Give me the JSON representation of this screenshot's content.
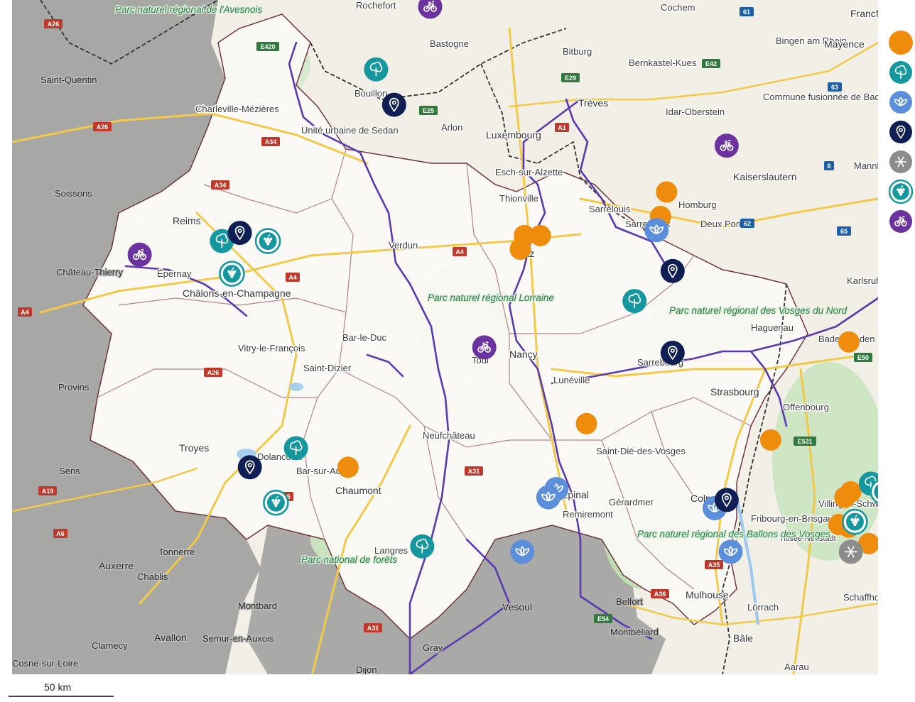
{
  "map": {
    "labels": {
      "cities": [
        "Rochefort",
        "Cochem",
        "Bastogne",
        "Bitburg",
        "Bingen am Rhein",
        "Mayence",
        "Saint-Quentin",
        "Charleville-Mézières",
        "Bouillon",
        "Bernkastel-Kues",
        "Trèves",
        "Idar-Oberstein",
        "Commune fusionnée de Bad Kreuznach",
        "Arlon",
        "Luxembourg",
        "Unité urbaine de Sedan",
        "Esch-sur-Alzette",
        "Kaiserslautern",
        "Mannheim",
        "Soissons",
        "Thionville",
        "Sarrelouis",
        "Homburg",
        "Sarrebruck",
        "Deux Ponts",
        "Reims",
        "Verdun",
        "Metz",
        "Karlsruhe",
        "Château-Thierry",
        "Épernay",
        "Châlons-en-Champagne",
        "Haguenau",
        "Bar-le-Duc",
        "Nancy",
        "Toul",
        "Vitry-le-François",
        "Saint-Dizier",
        "Lunéville",
        "Sarrebourg",
        "Baden-Baden",
        "Provins",
        "Strasbourg",
        "Offenbourg",
        "Troyes",
        "Dolancourt",
        "Bar-sur-Aube",
        "Neufchâteau",
        "Saint-Dié-des-Vosges",
        "Sens",
        "Chaumont",
        "Épinal",
        "Colmar",
        "Villingen-Schwenningen",
        "Remiremont",
        "Gérardmer",
        "Fribourg-en-Brisgau",
        "Titisee-Neustadt",
        "Tonnerre",
        "Langres",
        "Auxerre",
        "Chablis",
        "Mulhouse",
        "Lörrach",
        "Schaffhouse",
        "Montbard",
        "Vesoul",
        "Belfort",
        "Avallon",
        "Semur-en-Auxois",
        "Bâle",
        "Clamecy",
        "Cosne-sur-Loire",
        "Dijon",
        "Aarau",
        "Gray",
        "Montbéliard",
        "Francfort"
      ],
      "parks": [
        "Parc naturel régional de l'Avesnois",
        "Parc naturel régional Lorraine",
        "Parc naturel régional des Vosges du Nord",
        "Parc national de forêts",
        "Parc naturel régional des Ballons des Vosges"
      ],
      "roads": [
        "E420",
        "A26",
        "A34",
        "A4",
        "E25",
        "E29",
        "E42",
        "A1",
        "A31",
        "A5",
        "A19",
        "A6",
        "A35",
        "E54",
        "A36",
        "E531",
        "63",
        "61",
        "6",
        "62",
        "65",
        "E50"
      ]
    },
    "markers": [
      {
        "type": "orange",
        "lon": 5.44,
        "lat": 49.12
      },
      {
        "type": "orange",
        "lon": 5.52,
        "lat": 49.12
      },
      {
        "type": "orange",
        "lon": 5.42,
        "lat": 49.07
      },
      {
        "type": "orange",
        "lon": 6.15,
        "lat": 49.28
      },
      {
        "type": "orange",
        "lon": 6.12,
        "lat": 49.19
      },
      {
        "type": "orange",
        "lon": 7.06,
        "lat": 48.73
      },
      {
        "type": "orange",
        "lon": 5.75,
        "lat": 48.43
      },
      {
        "type": "orange",
        "lon": 6.67,
        "lat": 48.37
      },
      {
        "type": "orange",
        "lon": 4.56,
        "lat": 48.27
      },
      {
        "type": "orange",
        "lon": 7.34,
        "lat": 48.4
      },
      {
        "type": "orange",
        "lon": 7.52,
        "lat": 48.4
      },
      {
        "type": "orange",
        "lon": 7.45,
        "lat": 48.36
      },
      {
        "type": "orange",
        "lon": 7.51,
        "lat": 48.36
      },
      {
        "type": "orange",
        "lon": 7.43,
        "lat": 48.3
      },
      {
        "type": "orange",
        "lon": 7.44,
        "lat": 48.26
      },
      {
        "type": "orange",
        "lon": 7.07,
        "lat": 48.18
      },
      {
        "type": "orange",
        "lon": 7.04,
        "lat": 48.16
      },
      {
        "type": "orange",
        "lon": 7.01,
        "lat": 48.06
      },
      {
        "type": "orange",
        "lon": 7.06,
        "lat": 48.05
      },
      {
        "type": "orange",
        "lon": 7.16,
        "lat": 47.99
      },
      {
        "type": "orange",
        "lon": 7.31,
        "lat": 47.83
      },
      {
        "type": "tree",
        "lon": 4.7,
        "lat": 49.73
      },
      {
        "type": "tree",
        "lon": 3.93,
        "lat": 49.1
      },
      {
        "type": "tree",
        "lon": 5.99,
        "lat": 48.88
      },
      {
        "type": "tree",
        "lon": 7.43,
        "lat": 48.94
      },
      {
        "type": "tree",
        "lon": 4.3,
        "lat": 48.34
      },
      {
        "type": "tree",
        "lon": 4.93,
        "lat": 47.98
      },
      {
        "type": "tree",
        "lon": 7.17,
        "lat": 48.21
      },
      {
        "type": "lotus",
        "lon": 6.1,
        "lat": 49.14
      },
      {
        "type": "lotus",
        "lon": 7.82,
        "lat": 48.82
      },
      {
        "type": "lotus",
        "lon": 5.6,
        "lat": 48.19
      },
      {
        "type": "lotus",
        "lon": 5.56,
        "lat": 48.16
      },
      {
        "type": "lotus",
        "lon": 6.39,
        "lat": 48.12
      },
      {
        "type": "lotus",
        "lon": 5.43,
        "lat": 47.96
      },
      {
        "type": "lotus",
        "lon": 6.47,
        "lat": 47.96
      },
      {
        "type": "lotus",
        "lon": 7.31,
        "lat": 48.03
      },
      {
        "type": "pin",
        "lon": 4.79,
        "lat": 49.6
      },
      {
        "type": "pin",
        "lon": 4.02,
        "lat": 49.13
      },
      {
        "type": "pin",
        "lon": 6.18,
        "lat": 48.99
      },
      {
        "type": "pin",
        "lon": 6.18,
        "lat": 48.69
      },
      {
        "type": "pin",
        "lon": 7.75,
        "lat": 48.55
      },
      {
        "type": "pin",
        "lon": 4.07,
        "lat": 48.27
      },
      {
        "type": "pin",
        "lon": 6.45,
        "lat": 48.15
      },
      {
        "type": "pin",
        "lon": 7.37,
        "lat": 48.05
      },
      {
        "type": "pin",
        "lon": 7.34,
        "lat": 47.75
      },
      {
        "type": "snow",
        "lon": 7.07,
        "lat": 47.96
      },
      {
        "type": "grape",
        "lon": 4.16,
        "lat": 49.1
      },
      {
        "type": "grape",
        "lon": 3.98,
        "lat": 48.98
      },
      {
        "type": "grape",
        "lon": 7.68,
        "lat": 48.38
      },
      {
        "type": "grape",
        "lon": 7.23,
        "lat": 48.18
      },
      {
        "type": "grape",
        "lon": 7.09,
        "lat": 48.07
      },
      {
        "type": "grape",
        "lon": 4.2,
        "lat": 48.14
      },
      {
        "type": "bike",
        "lon": 4.97,
        "lat": 49.96
      },
      {
        "type": "bike",
        "lon": 6.45,
        "lat": 49.45
      },
      {
        "type": "bike",
        "lon": 3.52,
        "lat": 49.05
      },
      {
        "type": "bike",
        "lon": 5.24,
        "lat": 48.71
      },
      {
        "type": "bike",
        "lon": 7.28,
        "lat": 48.72
      }
    ]
  },
  "legend": [
    "orange",
    "tree",
    "lotus",
    "pin",
    "snow",
    "grape",
    "bike"
  ],
  "colors": {
    "orange": "#ef8c0c",
    "tree": "#1597a0",
    "lotus": "#5b8fdc",
    "pin": "#0f1f54",
    "snow": "#8c8c8c",
    "grape": "#1597a0",
    "bike": "#6c33a0",
    "route": "#5a3ab0"
  },
  "scale": {
    "label": "50 km"
  }
}
